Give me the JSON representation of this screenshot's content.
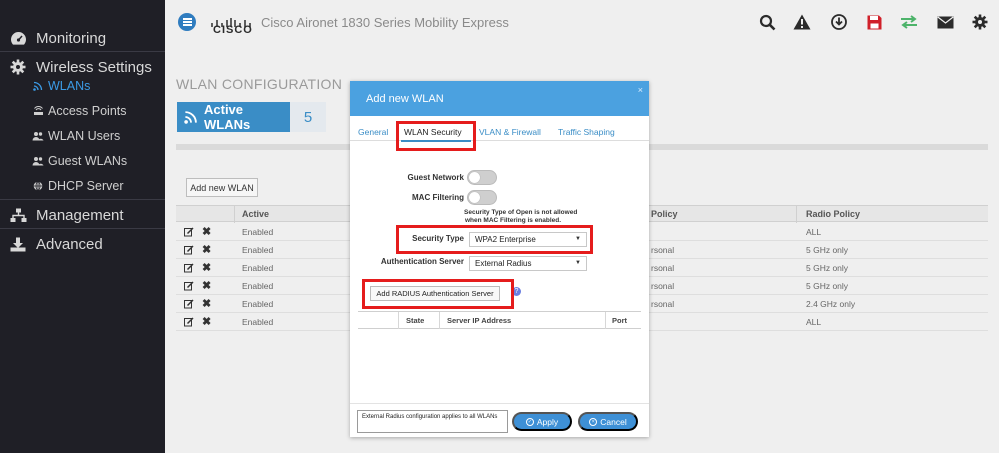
{
  "sidebar": {
    "items": [
      {
        "label": "Monitoring",
        "icon": "dashboard-icon"
      },
      {
        "label": "Wireless Settings",
        "icon": "gear-icon"
      },
      {
        "label": "Management",
        "icon": "network-icon"
      },
      {
        "label": "Advanced",
        "icon": "download-icon"
      }
    ],
    "sub_items": [
      {
        "label": "WLANs",
        "icon": "wifi-icon",
        "active": true
      },
      {
        "label": "Access Points",
        "icon": "access-point-icon"
      },
      {
        "label": "WLAN Users",
        "icon": "users-icon"
      },
      {
        "label": "Guest WLANs",
        "icon": "users-icon"
      },
      {
        "label": "DHCP Server",
        "icon": "globe-icon"
      }
    ]
  },
  "header": {
    "brand": "CISCO",
    "title": "Cisco Aironet 1830 Series Mobility Express",
    "icons": [
      "search-icon",
      "warning-icon",
      "download-icon",
      "save-icon",
      "transfer-icon",
      "mail-icon",
      "gear-icon"
    ]
  },
  "main": {
    "page_title": "WLAN CONFIGURATION",
    "active_wlans_label": "Active WLANs",
    "active_wlans_count": "5",
    "add_wlan_label": "Add new WLAN",
    "table": {
      "headers": [
        "Active",
        "Policy",
        "Radio Policy"
      ],
      "rows": [
        {
          "active": "Enabled",
          "policy": "",
          "radio": "ALL"
        },
        {
          "active": "Enabled",
          "policy": "rsonal",
          "radio": "5 GHz only"
        },
        {
          "active": "Enabled",
          "policy": "rsonal",
          "radio": "5 GHz only"
        },
        {
          "active": "Enabled",
          "policy": "rsonal",
          "radio": "5 GHz only"
        },
        {
          "active": "Enabled",
          "policy": "rsonal",
          "radio": "2.4 GHz only"
        },
        {
          "active": "Enabled",
          "policy": "",
          "radio": "ALL"
        }
      ]
    }
  },
  "modal": {
    "title": "Add new WLAN",
    "close": "×",
    "tabs": [
      "General",
      "WLAN Security",
      "VLAN & Firewall",
      "Traffic Shaping"
    ],
    "guest_network_label": "Guest Network",
    "mac_filtering_label": "MAC Filtering",
    "note_line1": "Security Type of Open is not allowed",
    "note_line2": "when MAC Filtering is enabled.",
    "security_type_label": "Security Type",
    "security_type_value": "WPA2 Enterprise",
    "auth_server_label": "Authentication Server",
    "auth_server_value": "External Radius",
    "add_radius_label": "Add RADIUS Authentication Server",
    "help": "?",
    "server_table_headers": [
      "State",
      "Server IP Address",
      "Port"
    ],
    "footer_note": "External Radius configuration applies to all WLANs",
    "apply_label": "Apply",
    "cancel_label": "Cancel"
  },
  "colors": {
    "sidebar_bg": "#1f1f26",
    "accent": "#3a8dc6",
    "modal_header": "#4ba1e0",
    "highlight": "#e51c1c"
  }
}
